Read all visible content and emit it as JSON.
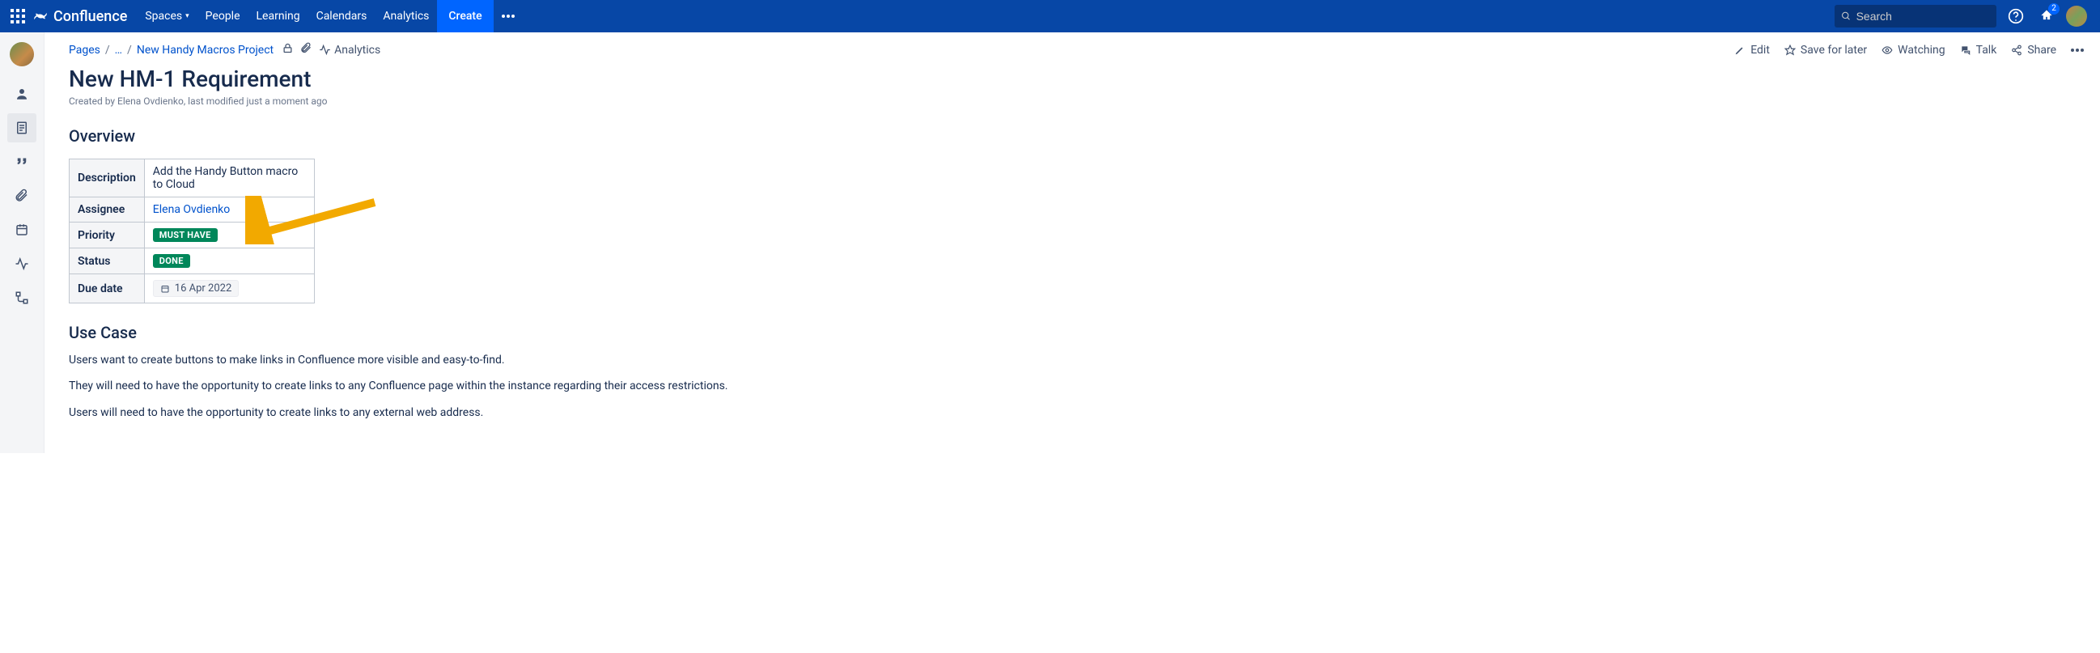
{
  "app": {
    "name": "Confluence",
    "nav": {
      "spaces": "Spaces",
      "people": "People",
      "learning": "Learning",
      "calendars": "Calendars",
      "analytics": "Analytics"
    },
    "create": "Create",
    "search_placeholder": "Search",
    "notif_count": "2"
  },
  "breadcrumbs": {
    "pages": "Pages",
    "ellipsis": "…",
    "project": "New Handy Macros Project",
    "analytics": "Analytics"
  },
  "actions": {
    "edit": "Edit",
    "save": "Save for later",
    "watching": "Watching",
    "talk": "Talk",
    "share": "Share"
  },
  "page": {
    "title": "New HM-1 Requirement",
    "byline": "Created by Elena Ovdienko, last modified just a moment ago"
  },
  "overview": {
    "heading": "Overview",
    "rows": {
      "description_label": "Description",
      "description_value": "Add the Handy Button macro to Cloud",
      "assignee_label": "Assignee",
      "assignee_value": "Elena Ovdienko",
      "priority_label": "Priority",
      "priority_value": "MUST HAVE",
      "status_label": "Status",
      "status_value": "DONE",
      "duedate_label": "Due date",
      "duedate_value": "16 Apr 2022"
    }
  },
  "usecase": {
    "heading": "Use Case",
    "p1": "Users want to create buttons to make links in Confluence more visible and easy-to-find.",
    "p2": "They will need to have the opportunity to create links to any Confluence page within the instance regarding their access restrictions.",
    "p3": "Users will need to have the opportunity to create links to any external web address."
  }
}
